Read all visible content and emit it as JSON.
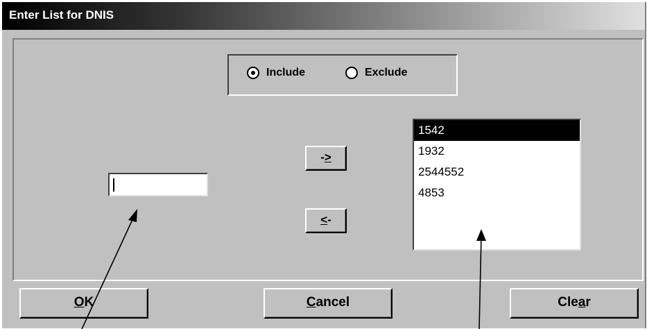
{
  "window": {
    "title": "Enter List for DNIS"
  },
  "mode": {
    "options": [
      {
        "label": "Include",
        "selected": true
      },
      {
        "label": "Exclude",
        "selected": false
      }
    ]
  },
  "entry": {
    "value": ""
  },
  "buttons": {
    "add_pre": "-",
    "add_key": ">",
    "remove_key": "<",
    "remove_post": "-",
    "ok_key": "O",
    "ok_rest": "K",
    "cancel_key": "C",
    "cancel_rest": "ancel",
    "clear_pre": "Cle",
    "clear_key": "a",
    "clear_post": "r"
  },
  "list": {
    "items": [
      "1542",
      "1932",
      "2544552",
      "4853"
    ],
    "selected_index": 0
  }
}
